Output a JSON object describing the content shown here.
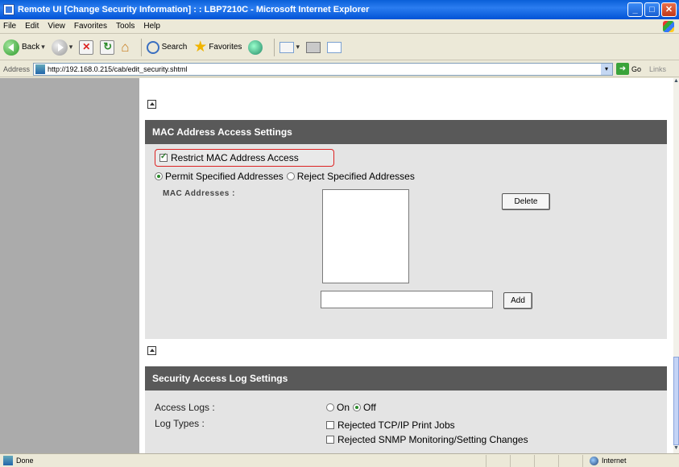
{
  "window": {
    "title": "Remote UI [Change Security Information] : : LBP7210C - Microsoft Internet Explorer"
  },
  "menu": [
    "File",
    "Edit",
    "View",
    "Favorites",
    "Tools",
    "Help"
  ],
  "toolbar": {
    "back_label": "Back",
    "search_label": "Search",
    "favorites_label": "Favorites"
  },
  "address": {
    "label": "Address",
    "url": "http://192.168.0.215/cab/edit_security.shtml",
    "go_label": "Go",
    "links_label": "Links"
  },
  "mac_section": {
    "header": "MAC Address Access Settings",
    "restrict_label": "Restrict MAC Address Access",
    "restrict_checked": true,
    "permit_label": "Permit Specified Addresses",
    "reject_label": "Reject Specified Addresses",
    "selected_mode": "permit",
    "addresses_label": "MAC Addresses :",
    "delete_label": "Delete",
    "add_label": "Add",
    "addresses": [],
    "new_address_value": ""
  },
  "log_section": {
    "header": "Security Access Log Settings",
    "access_logs_label": "Access Logs :",
    "on_label": "On",
    "off_label": "Off",
    "access_logs_value": "off",
    "log_types_label": "Log Types :",
    "log_types": [
      {
        "label": "Rejected TCP/IP Print Jobs",
        "checked": false
      },
      {
        "label": "Rejected SNMP Monitoring/Setting Changes",
        "checked": false
      }
    ]
  },
  "status": {
    "text": "Done",
    "zone": "Internet"
  }
}
